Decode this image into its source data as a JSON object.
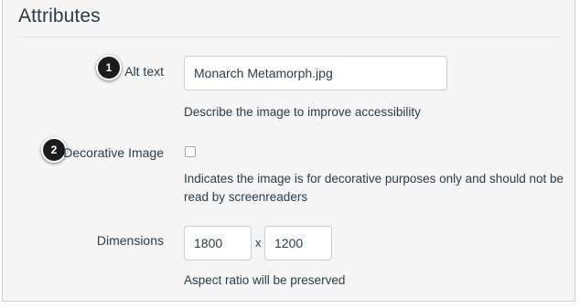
{
  "section": {
    "title": "Attributes"
  },
  "alt_text": {
    "label": "Alt text",
    "value": "Monarch Metamorph.jpg",
    "help": "Describe the image to improve accessibility",
    "callout": "1"
  },
  "decorative": {
    "label": "Decorative Image",
    "checked": false,
    "help": "Indicates the image is for decorative purposes only and should not be read by screenreaders",
    "callout": "2"
  },
  "dimensions": {
    "label": "Dimensions",
    "width": "1800",
    "separator": "x",
    "height": "1200",
    "help": "Aspect ratio will be preserved"
  }
}
